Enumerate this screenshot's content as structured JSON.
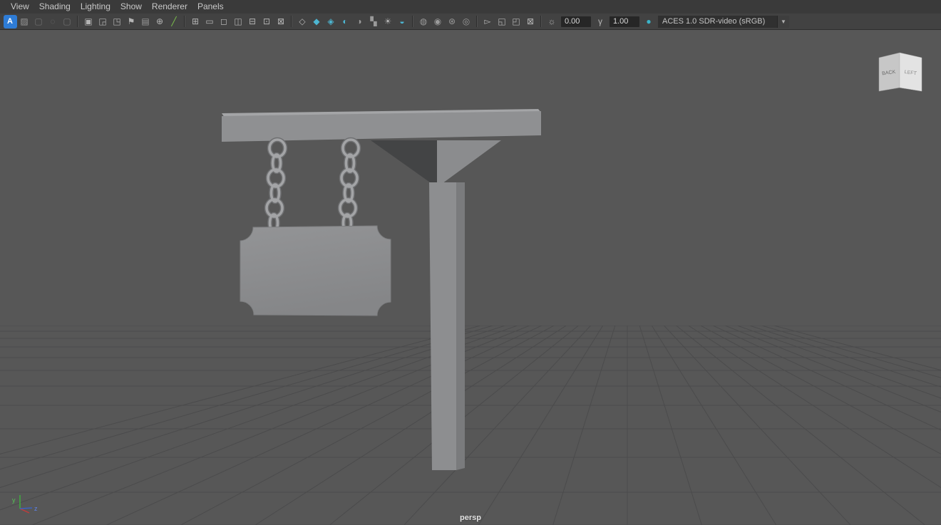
{
  "window_title": "Maya perspective viewport",
  "colors": {
    "viewport_background": "#575757",
    "grid_line": "#4b4b4c",
    "model_gray": "#8f9092",
    "accent_teal": "#4db6d2",
    "accent_blue": "#2e7cd6"
  },
  "menu_bar": {
    "items": [
      "View",
      "Shading",
      "Lighting",
      "Show",
      "Renderer",
      "Panels"
    ]
  },
  "toolbar": {
    "exposure_value": "0.00",
    "gamma_value": "1.00",
    "color_space": "ACES 1.0 SDR-video (sRGB)",
    "items": [
      {
        "type": "icon",
        "name": "a-badge-icon",
        "glyph": "A",
        "color": "#ffffff",
        "bg": "#2e7cd6"
      },
      {
        "type": "icon",
        "name": "image-icon",
        "glyph": "▨",
        "color": "#9a9a9a"
      },
      {
        "type": "icon",
        "name": "disabled-icon-1",
        "glyph": "▢",
        "color": "#707070"
      },
      {
        "type": "icon",
        "name": "disabled-icon-2",
        "glyph": "◌",
        "color": "#707070"
      },
      {
        "type": "icon",
        "name": "disabled-icon-3",
        "glyph": "▢",
        "color": "#707070"
      },
      {
        "type": "sep"
      },
      {
        "type": "icon",
        "name": "select-camera-icon",
        "glyph": "▣",
        "color": "#b4b4b4"
      },
      {
        "type": "icon",
        "name": "camera-settings-icon",
        "glyph": "◲",
        "color": "#b4b4b4"
      },
      {
        "type": "icon",
        "name": "lock-camera-icon",
        "glyph": "◳",
        "color": "#b4b4b4"
      },
      {
        "type": "icon",
        "name": "bookmark-icon",
        "glyph": "⚑",
        "color": "#b4b4b4"
      },
      {
        "type": "icon",
        "name": "image-plane-icon",
        "glyph": "▤",
        "color": "#9a9a9a"
      },
      {
        "type": "icon",
        "name": "pan-zoom-icon",
        "glyph": "⊕",
        "color": "#b4b4b4"
      },
      {
        "type": "icon",
        "name": "grease-pencil-icon",
        "glyph": "╱",
        "color": "#7cc14b"
      },
      {
        "type": "sep"
      },
      {
        "type": "icon",
        "name": "grid-icon",
        "glyph": "⊞",
        "color": "#b4b4b4"
      },
      {
        "type": "icon",
        "name": "film-gate-icon",
        "glyph": "▭",
        "color": "#b4b4b4"
      },
      {
        "type": "icon",
        "name": "resolution-gate-icon",
        "glyph": "◻",
        "color": "#b4b4b4"
      },
      {
        "type": "icon",
        "name": "gate-mask-icon",
        "glyph": "◫",
        "color": "#b4b4b4"
      },
      {
        "type": "icon",
        "name": "field-chart-icon",
        "glyph": "⊟",
        "color": "#b4b4b4"
      },
      {
        "type": "icon",
        "name": "safe-action-icon",
        "glyph": "⊡",
        "color": "#b4b4b4"
      },
      {
        "type": "icon",
        "name": "safe-title-icon",
        "glyph": "⊠",
        "color": "#b4b4b4"
      },
      {
        "type": "sep"
      },
      {
        "type": "icon",
        "name": "wireframe-icon",
        "glyph": "◇",
        "color": "#b4b4b4"
      },
      {
        "type": "icon",
        "name": "smooth-shade-icon",
        "glyph": "◆",
        "color": "#4db6d2"
      },
      {
        "type": "icon",
        "name": "wireframe-on-shaded-icon",
        "glyph": "◈",
        "color": "#4db6d2"
      },
      {
        "type": "icon",
        "name": "textured-icon",
        "glyph": "◐",
        "color": "#4db6d2"
      },
      {
        "type": "icon",
        "name": "use-default-material-icon",
        "glyph": "◑",
        "color": "#9a9a9a"
      },
      {
        "type": "icon",
        "name": "checker-icon",
        "glyph": "▚",
        "color": "#9a9a9a"
      },
      {
        "type": "icon",
        "name": "lighting-icon",
        "glyph": "☀",
        "color": "#b4b4b4"
      },
      {
        "type": "icon",
        "name": "shadows-icon",
        "glyph": "◒",
        "color": "#4db6d2"
      },
      {
        "type": "sep"
      },
      {
        "type": "icon",
        "name": "occlusion-icon",
        "glyph": "◍",
        "color": "#9a9a9a"
      },
      {
        "type": "icon",
        "name": "motion-blur-icon",
        "glyph": "◉",
        "color": "#9a9a9a"
      },
      {
        "type": "icon",
        "name": "multisample-icon",
        "glyph": "⊛",
        "color": "#9a9a9a"
      },
      {
        "type": "icon",
        "name": "depth-of-field-icon",
        "glyph": "◎",
        "color": "#9a9a9a"
      },
      {
        "type": "sep"
      },
      {
        "type": "icon",
        "name": "isolate-select-icon",
        "glyph": "▻",
        "color": "#b4b4b4"
      },
      {
        "type": "icon",
        "name": "duplicate-view-icon",
        "glyph": "◱",
        "color": "#b4b4b4"
      },
      {
        "type": "icon",
        "name": "pane-layout-icon",
        "glyph": "◰",
        "color": "#b4b4b4"
      },
      {
        "type": "icon",
        "name": "snapshot-icon",
        "glyph": "⊠",
        "color": "#b4b4b4"
      },
      {
        "type": "sep"
      },
      {
        "type": "icon",
        "name": "exposure-icon",
        "glyph": "☼",
        "color": "#b4b4b4"
      },
      {
        "type": "field",
        "name": "exposure-input",
        "bind": "exposure_value"
      },
      {
        "type": "icon",
        "name": "gamma-icon",
        "glyph": "γ",
        "color": "#b4b4b4"
      },
      {
        "type": "field",
        "name": "gamma-input",
        "bind": "gamma_value"
      },
      {
        "type": "icon",
        "name": "color-management-icon",
        "glyph": "●",
        "color": "#3ab3c9"
      },
      {
        "type": "dropdown",
        "name": "color-space-select",
        "bind": "color_space"
      }
    ]
  },
  "viewport": {
    "camera_label": "persp",
    "view_cube": {
      "left_face": "BACK",
      "right_face": "LEFT"
    },
    "axis_gizmo": {
      "y_label": "y",
      "z_label": "z"
    }
  }
}
